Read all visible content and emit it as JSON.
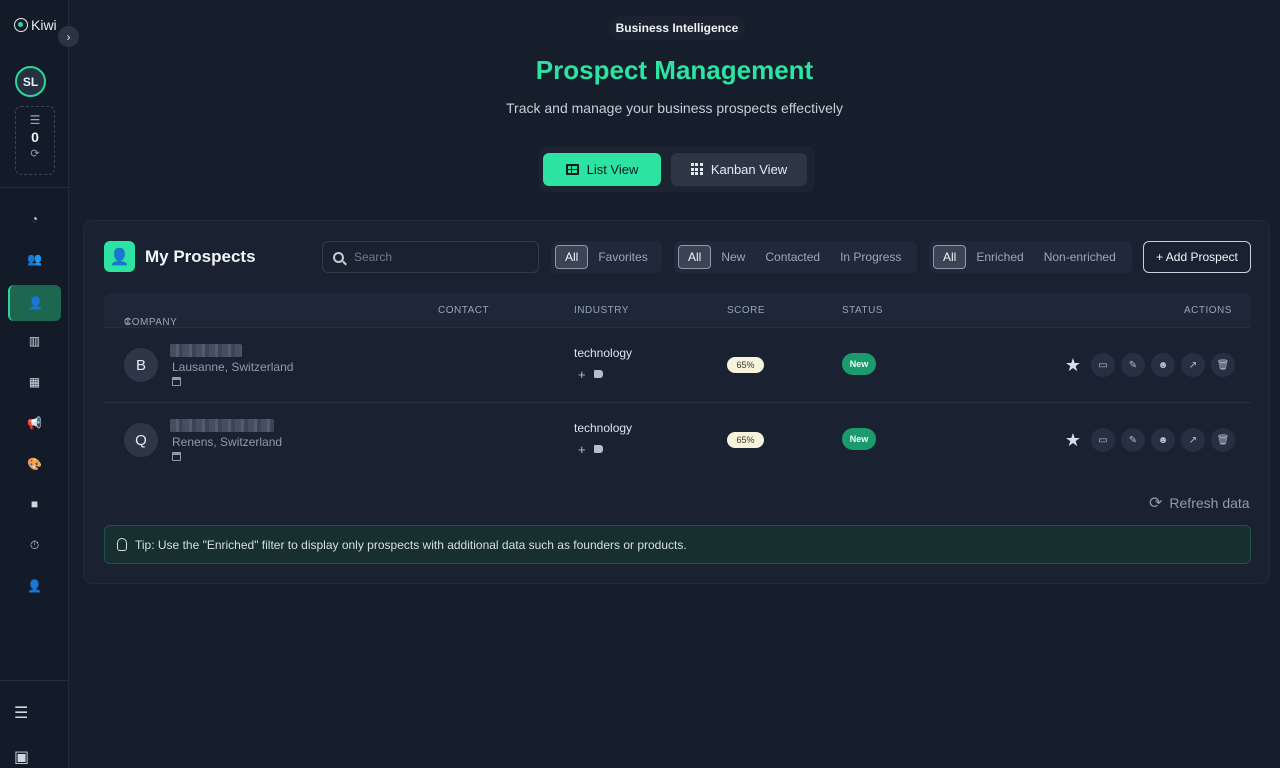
{
  "sidebar": {
    "logo_text": "Kiwi",
    "user_initials": "SL",
    "credits": "0",
    "nav_items": [
      {
        "name": "dashboard",
        "icon": "gauge-icon",
        "glyph": "◔"
      },
      {
        "name": "contacts",
        "icon": "users-icon",
        "glyph": "👥"
      },
      {
        "name": "prospects",
        "icon": "user-plus-icon",
        "glyph": "👤",
        "active": true
      },
      {
        "name": "analytics",
        "icon": "bar-chart-icon",
        "glyph": "▥"
      },
      {
        "name": "calculator",
        "icon": "calculator-icon",
        "glyph": "▦"
      },
      {
        "name": "campaigns",
        "icon": "megaphone-icon",
        "glyph": "📢"
      },
      {
        "name": "design",
        "icon": "palette-icon",
        "glyph": "🎨"
      },
      {
        "name": "video",
        "icon": "video-icon",
        "glyph": "■"
      },
      {
        "name": "timer",
        "icon": "stopwatch-icon",
        "glyph": "⏱"
      },
      {
        "name": "user-settings",
        "icon": "user-gear-icon",
        "glyph": "👤"
      }
    ]
  },
  "header": {
    "section_badge": "Business Intelligence",
    "title": "Prospect Management",
    "subtitle": "Track and manage your business prospects effectively"
  },
  "views": {
    "list_label": "List View",
    "kanban_label": "Kanban View",
    "selected": "list"
  },
  "prospects": {
    "title": "My Prospects",
    "search_placeholder": "Search",
    "favorite_filter": [
      "All",
      "Favorites"
    ],
    "status_filter": [
      "All",
      "New",
      "Contacted",
      "In Progress"
    ],
    "enrichment_filter": [
      "All",
      "Enriched",
      "Non-enriched"
    ],
    "add_label": "+ Add Prospect",
    "columns": {
      "company": "COMPANY",
      "contact": "CONTACT",
      "industry": "INDUSTRY",
      "score": "SCORE",
      "status": "STATUS",
      "actions": "ACTIONS"
    },
    "rows": [
      {
        "initial": "B",
        "location": "Lausanne, Switzerland",
        "industry": "technology",
        "score": "65%",
        "status": "New"
      },
      {
        "initial": "Q",
        "location": "Renens, Switzerland",
        "industry": "technology",
        "score": "65%",
        "status": "New"
      }
    ],
    "refresh_label": "Refresh data",
    "tip": "Tip: Use the \"Enriched\" filter to display only prospects with additional data such as founders or products."
  },
  "colors": {
    "accent": "#2de3a2",
    "background": "#161d2b",
    "status_new": "#1b9a6e"
  }
}
